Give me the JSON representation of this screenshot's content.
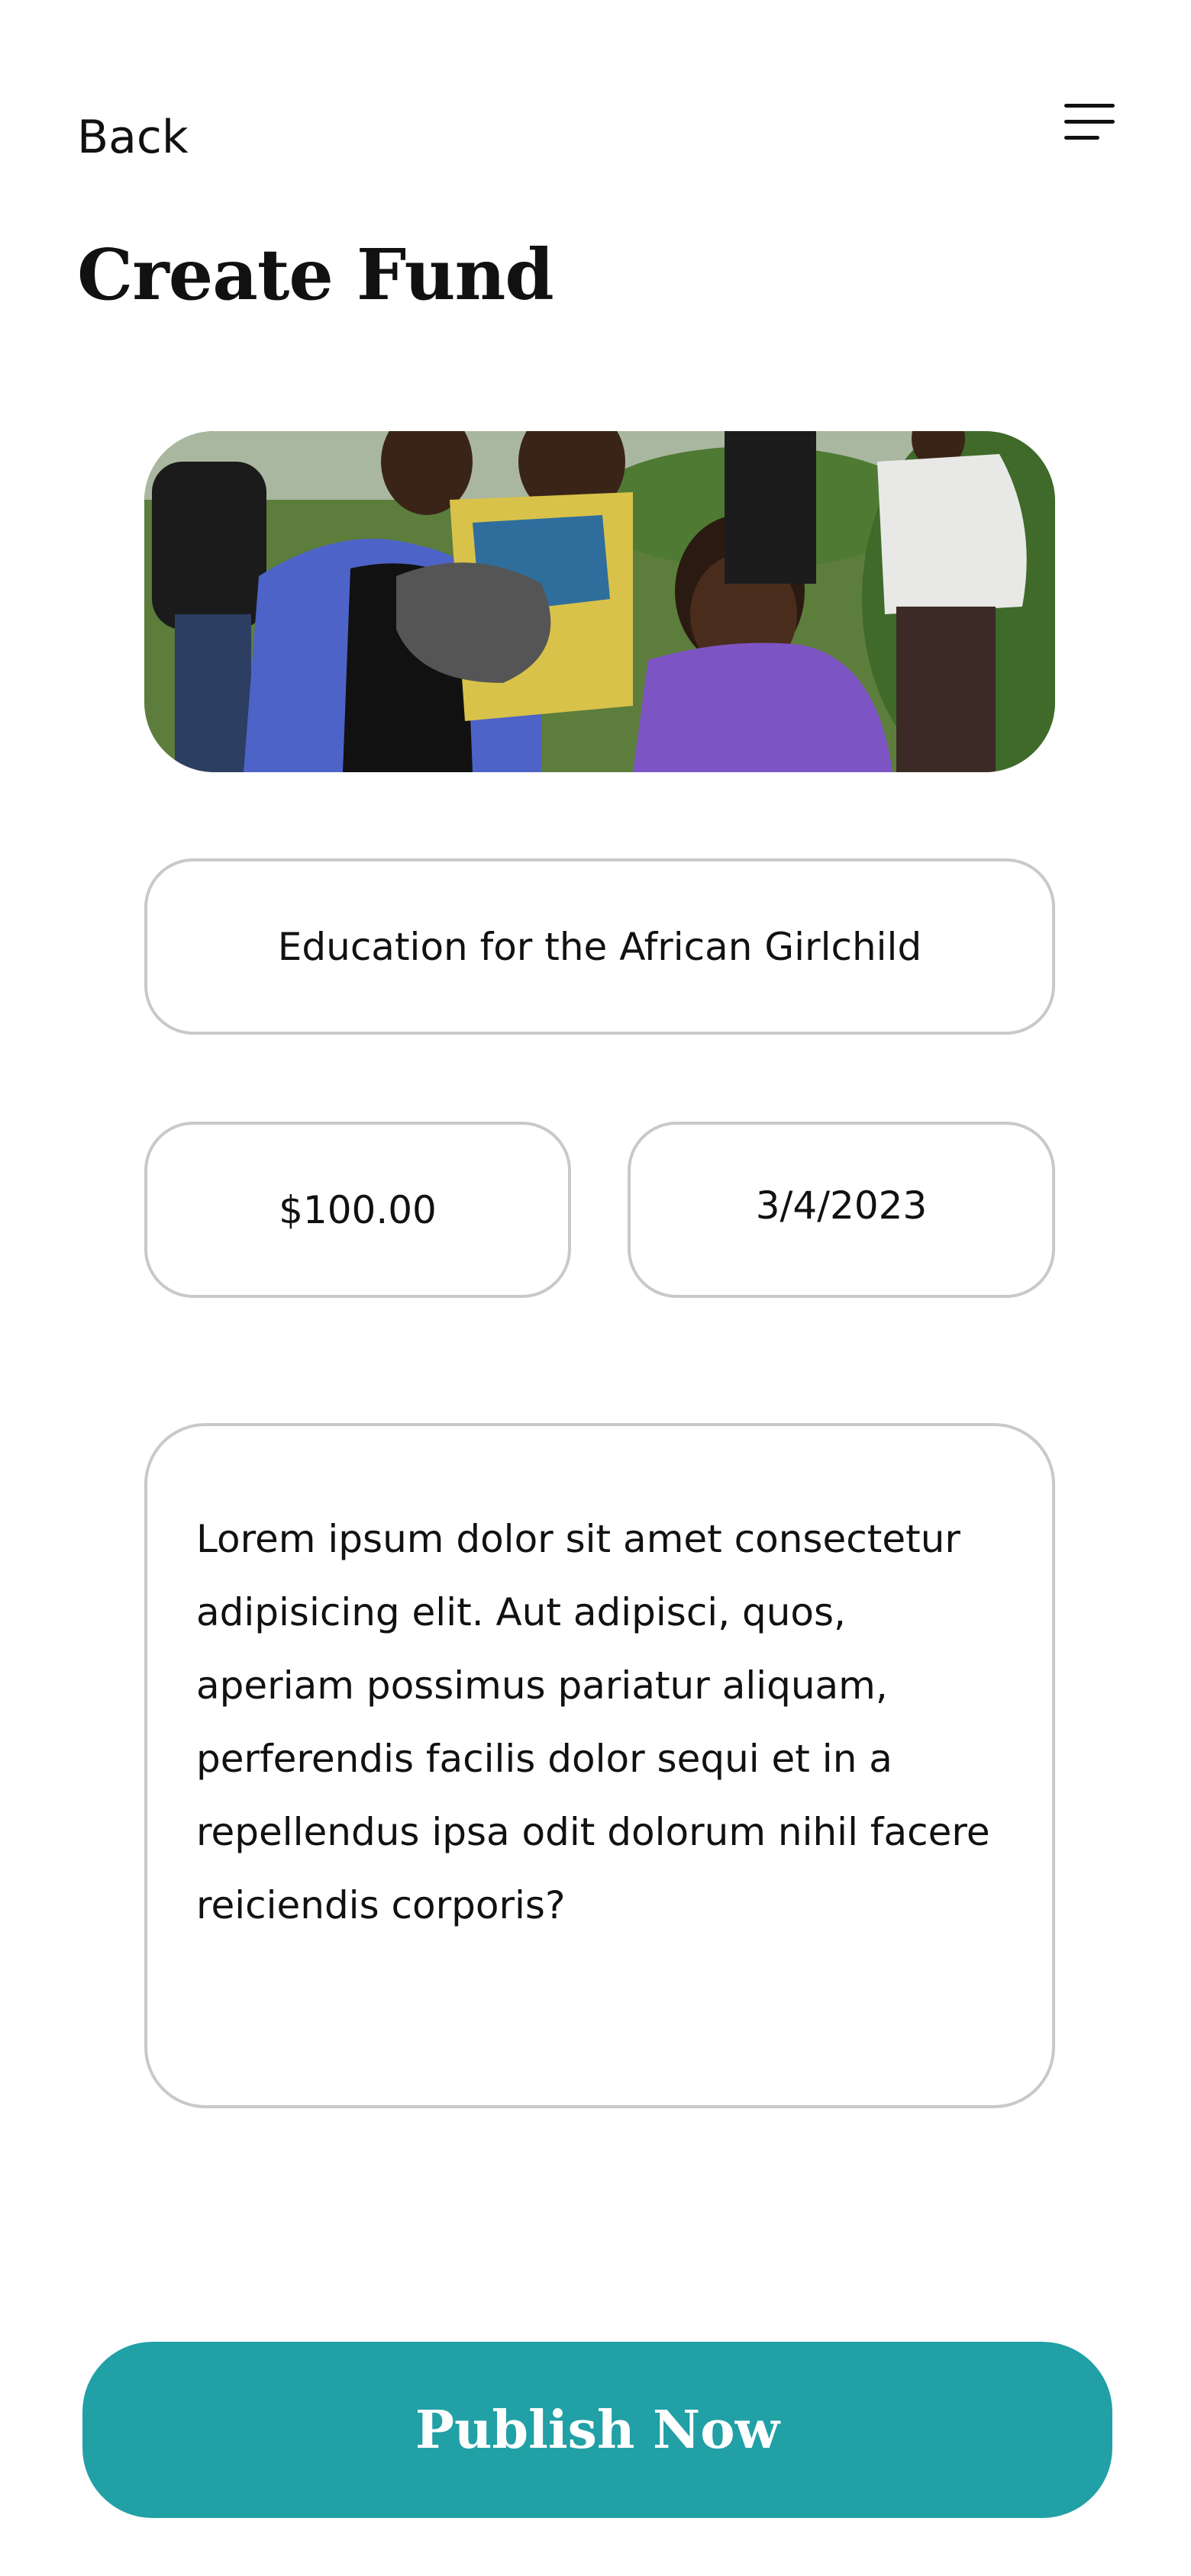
{
  "header": {
    "back_label": "Back",
    "menu_icon": "hamburger-menu-icon"
  },
  "page": {
    "title": "Create Fund"
  },
  "form": {
    "cover_image": "photo-of-children-and-young-women-outdoors",
    "fund_title": "Education for the African Girlchild",
    "amount": "$100.00",
    "date": "3/4/2023",
    "description": "Lorem ipsum dolor sit amet consectetur adipisicing elit. Aut adipisci, quos, aperiam possimus pariatur aliquam, perferendis facilis dolor sequi et in a repellendus ipsa odit dolorum nihil facere reiciendis corporis?"
  },
  "actions": {
    "publish_label": "Publish Now"
  },
  "colors": {
    "accent": "#21a0a6",
    "field_border": "#c9c9c9"
  }
}
